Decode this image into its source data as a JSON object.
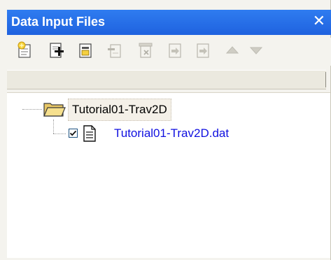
{
  "panel": {
    "title": "Data Input Files",
    "close_glyph": "✕"
  },
  "toolbar": {
    "buttons": [
      {
        "name": "new-group-icon",
        "enabled": true
      },
      {
        "name": "add-file-icon",
        "enabled": true
      },
      {
        "name": "properties-icon",
        "enabled": true
      },
      {
        "name": "remove-icon",
        "enabled": false
      },
      {
        "name": "delete-icon",
        "enabled": false
      },
      {
        "name": "import-icon",
        "enabled": false
      },
      {
        "name": "export-icon",
        "enabled": false
      },
      {
        "name": "move-up-icon",
        "enabled": false
      },
      {
        "name": "move-down-icon",
        "enabled": false
      }
    ]
  },
  "tree": {
    "group": {
      "label": "Tutorial01-Trav2D",
      "icon": "folder-open-icon"
    },
    "file": {
      "label": "Tutorial01-Trav2D.dat",
      "checked": true,
      "icon": "document-icon",
      "color": "#1010e0"
    }
  },
  "colors": {
    "title_bar": "#2469e8",
    "panel_bg": "#f4f3ee",
    "tree_bg": "#ffffff"
  }
}
